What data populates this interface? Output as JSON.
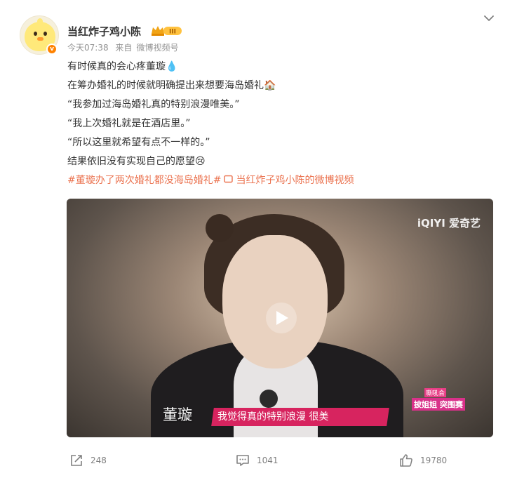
{
  "post": {
    "author": "当红炸子鸡小陈",
    "level_badge": "III",
    "verified_mark": "v",
    "time": "今天07:38",
    "source_prefix": "来自",
    "source": "微博视频号",
    "lines": [
      "有时候真的会心疼董璇💧",
      "在筹办婚礼的时候就明确提出来想要海岛婚礼🏠",
      "“我参加过海岛婚礼真的特别浪漫唯美。”",
      "“我上次婚礼就是在酒店里。”",
      "“所以这里就希望有点不一样的。”",
      "结果依旧没有实现自己的愿望😢"
    ],
    "hashtag": "#董璇办了两次婚礼都没海岛婚礼#",
    "video_link": "当红炸子鸡小陈的微博视频",
    "icons": {
      "more": "chevron-down-icon",
      "repost": "repost-icon",
      "comment": "comment-icon",
      "like": "thumbs-up-icon",
      "video_link": "video-icon"
    },
    "colors": {
      "hashtag": "#eb7350",
      "accent": "#ff8200",
      "subtitle_bar": "#d7245f"
    }
  },
  "video": {
    "watermark": "iQIYI 爱奇艺",
    "name_caption": "董璇",
    "subtitle": "我觉得真的特别浪漫  很美",
    "show_tag_top": "嘶吼合",
    "show_tag_main": "披姐姐 突围赛"
  },
  "footer": {
    "reposts": "248",
    "comments": "1041",
    "likes": "19780"
  }
}
